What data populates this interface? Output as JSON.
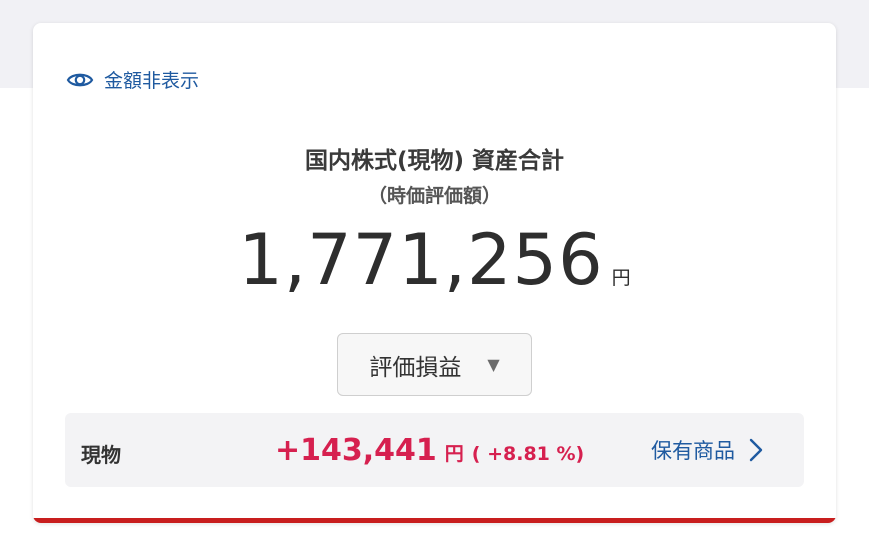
{
  "visibility_toggle": {
    "label": "金額非表示",
    "icon": "eye-icon"
  },
  "summary": {
    "title": "国内株式(現物) 資産合計",
    "subtitle": "（時価評価額）",
    "total_amount": "1,771,256",
    "currency_unit": "円"
  },
  "metric_select": {
    "selected": "評価損益",
    "icon": "dropdown-caret-icon"
  },
  "position_row": {
    "label": "現物",
    "gain_value": "+143,441",
    "gain_unit": "円",
    "gain_percent": "( +8.81 %)",
    "holdings_link": "保有商品",
    "icon": "chevron-right-icon"
  },
  "colors": {
    "accent_blue": "#1f5aa0",
    "gain_red": "#d6204f",
    "bottom_bar": "#c81e1e"
  }
}
